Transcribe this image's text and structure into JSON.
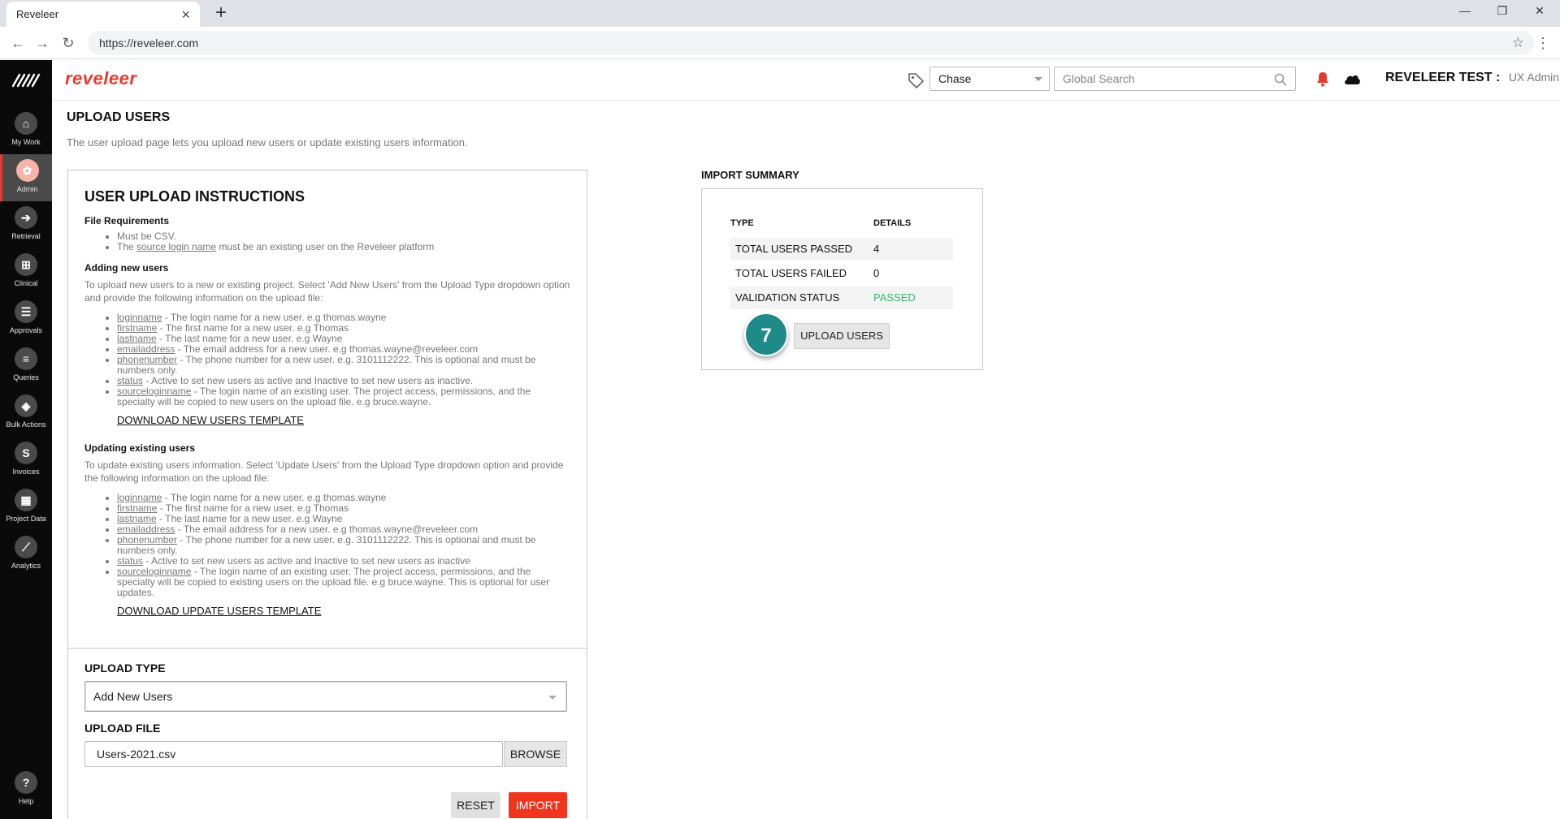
{
  "browser": {
    "tab_title": "Reveleer",
    "tab_close": "×",
    "new_tab": "+",
    "url": "https://reveleer.com",
    "controls": {
      "minimize": "—",
      "restore": "❐",
      "close": "✕"
    },
    "back": "←",
    "forward": "→",
    "reload": "↻",
    "star": "☆",
    "menu": "⋮"
  },
  "sidenav": {
    "items": [
      {
        "label": "My Work",
        "icon": "home-icon",
        "glyph": "⌂"
      },
      {
        "label": "Admin",
        "icon": "gear-icon",
        "glyph": "✿",
        "active": true
      },
      {
        "label": "Retrieval",
        "icon": "arrow-in-icon",
        "glyph": "➔"
      },
      {
        "label": "Clinical",
        "icon": "clipboard-plus-icon",
        "glyph": "⊞"
      },
      {
        "label": "Approvals",
        "icon": "checklist-icon",
        "glyph": "☰"
      },
      {
        "label": "Queries",
        "icon": "list-icon",
        "glyph": "≡"
      },
      {
        "label": "Bulk Actions",
        "icon": "layers-icon",
        "glyph": "◈"
      },
      {
        "label": "Invoices",
        "icon": "dollar-icon",
        "glyph": "S"
      },
      {
        "label": "Project Data",
        "icon": "project-data-icon",
        "glyph": "▦"
      },
      {
        "label": "Analytics",
        "icon": "chart-icon",
        "glyph": "⟋"
      },
      {
        "label": "Help",
        "icon": "help-icon",
        "glyph": "?"
      }
    ]
  },
  "header": {
    "brand": "reveleer",
    "project_select": "Chase",
    "search_placeholder": "Global Search",
    "org": "REVELEER TEST :",
    "role": "UX Admin"
  },
  "page": {
    "title": "UPLOAD USERS",
    "description": "The user upload page lets you upload new users or update existing users information."
  },
  "instructions": {
    "title": "USER UPLOAD INSTRUCTIONS",
    "file_req_title": "File Requirements",
    "file_req": {
      "item1": "Must be CSV.",
      "item2_pre": "The ",
      "item2_key": "source login name",
      "item2_post": " must be an existing user on the Reveleer platform"
    },
    "adding_title": "Adding new users",
    "adding_desc": "To upload new users to a new or existing project. Select 'Add New Users' from the Upload Type dropdown option and provide the following information on the upload file:",
    "adding_items": [
      {
        "key": "loginname",
        "text": " - The login name for a new user. e.g thomas.wayne"
      },
      {
        "key": "firstname",
        "text": " - The first name for a new user. e.g Thomas"
      },
      {
        "key": "lastname",
        "text": " - The last name for a new user. e.g Wayne"
      },
      {
        "key": "emailaddress",
        "text": " - The email address for a new user. e.g thomas.wayne@reveleer.com"
      },
      {
        "key": "phonenumber",
        "text": " - The phone number for a new user. e.g. 3101112222. This is optional and must be numbers only."
      },
      {
        "key": "status",
        "text": " - Active to set new users as active and Inactive to set new users as inactive."
      },
      {
        "key": "sourceloginname",
        "text": " - The login name of an existing user. The project access, permissions, and the specialty will be copied to new users on the upload file. e.g bruce.wayne."
      }
    ],
    "download_new": "DOWNLOAD NEW USERS TEMPLATE",
    "updating_title": "Updating existing users",
    "updating_desc": "To update existing users information. Select 'Update Users' from the Upload Type dropdown option and provide the following information on the upload file:",
    "updating_items": [
      {
        "key": "loginname",
        "text": " - The login name for a new user. e.g thomas.wayne"
      },
      {
        "key": "firstname",
        "text": " - The first name for a new user. e.g Thomas"
      },
      {
        "key": "lastname",
        "text": " - The last name for a new user. e.g Wayne"
      },
      {
        "key": "emailaddress",
        "text": " - The email address for a new user. e.g thomas.wayne@reveleer.com"
      },
      {
        "key": "phonenumber",
        "text": " - The phone number for a new user. e.g. 3101112222. This is optional and must be numbers only."
      },
      {
        "key": "status",
        "text": " - Active to set new users as active and Inactive to set new users as inactive"
      },
      {
        "key": "sourceloginname",
        "text": " - The login name of an existing user. The project access, permissions, and the specialty will be copied to existing users on the upload file. e.g bruce.wayne. This is optional for user updates."
      }
    ],
    "download_update": "DOWNLOAD UPDATE USERS TEMPLATE"
  },
  "upload": {
    "type_label": "UPLOAD TYPE",
    "type_value": "Add New Users",
    "file_label": "UPLOAD FILE",
    "file_value": "Users-2021.csv",
    "browse": "BROWSE",
    "reset": "RESET",
    "import": "IMPORT"
  },
  "summary": {
    "title": "IMPORT SUMMARY",
    "col_type": "TYPE",
    "col_details": "DETAILS",
    "rows": [
      {
        "label": "TOTAL USERS PASSED",
        "value": "4"
      },
      {
        "label": "TOTAL USERS FAILED",
        "value": "0"
      },
      {
        "label": "VALIDATION STATUS",
        "value": "PASSED"
      }
    ],
    "step_badge": "7",
    "upload_button": "UPLOAD USERS"
  },
  "colors": {
    "brand": "#e63a2e",
    "import": "#f0341e",
    "passed": "#3ab66a",
    "step_badge": "#1f8a8a"
  }
}
